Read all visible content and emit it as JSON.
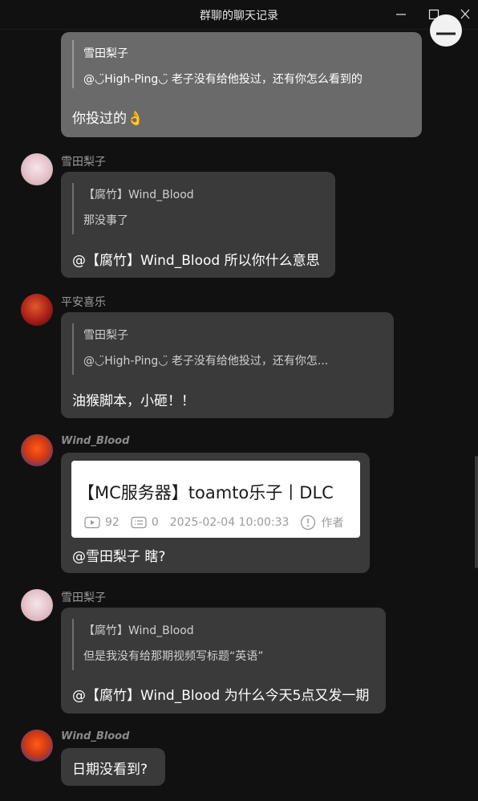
{
  "window": {
    "title": "群聊的聊天记录",
    "minimize_icon": "minimize-icon",
    "maximize_icon": "maximize-icon",
    "close_icon": "close-icon"
  },
  "messages": [
    {
      "sender": "",
      "quote": {
        "name": "雪田梨子",
        "text": "@◡̈High-Ping◡̈ 老子没有给他投过，还有你怎么看到的"
      },
      "text": "你投过的👌"
    },
    {
      "sender": "雪田梨子",
      "quote": {
        "name": "【腐竹】Wind_Blood",
        "text": "那没事了"
      },
      "text": "@【腐竹】Wind_Blood 所以你什么意思"
    },
    {
      "sender": "平安喜乐",
      "quote": {
        "name": "雪田梨子",
        "text": "@◡̈High-Ping◡̈ 老子没有给他投过，还有你怎..."
      },
      "text": "油猴脚本，小砸！！"
    },
    {
      "sender": "Wind_Blood",
      "card": {
        "title": "【MC服务器】toamto乐子丨DLC",
        "plays": "92",
        "comments": "0",
        "date": "2025-02-04 10:00:33",
        "author": "作者"
      },
      "text": "@雪田梨子 瞎?"
    },
    {
      "sender": "雪田梨子",
      "quote": {
        "name": "【腐竹】Wind_Blood",
        "text": "但是我没有给那期视频写标题“英语”"
      },
      "text": "@【腐竹】Wind_Blood 为什么今天5点又发一期"
    },
    {
      "sender": "Wind_Blood",
      "text": "日期没看到?"
    }
  ],
  "colors": {
    "background": "#111111",
    "bubble": "#3a3a3a",
    "bubble_highlight": "#6a6a6a"
  }
}
